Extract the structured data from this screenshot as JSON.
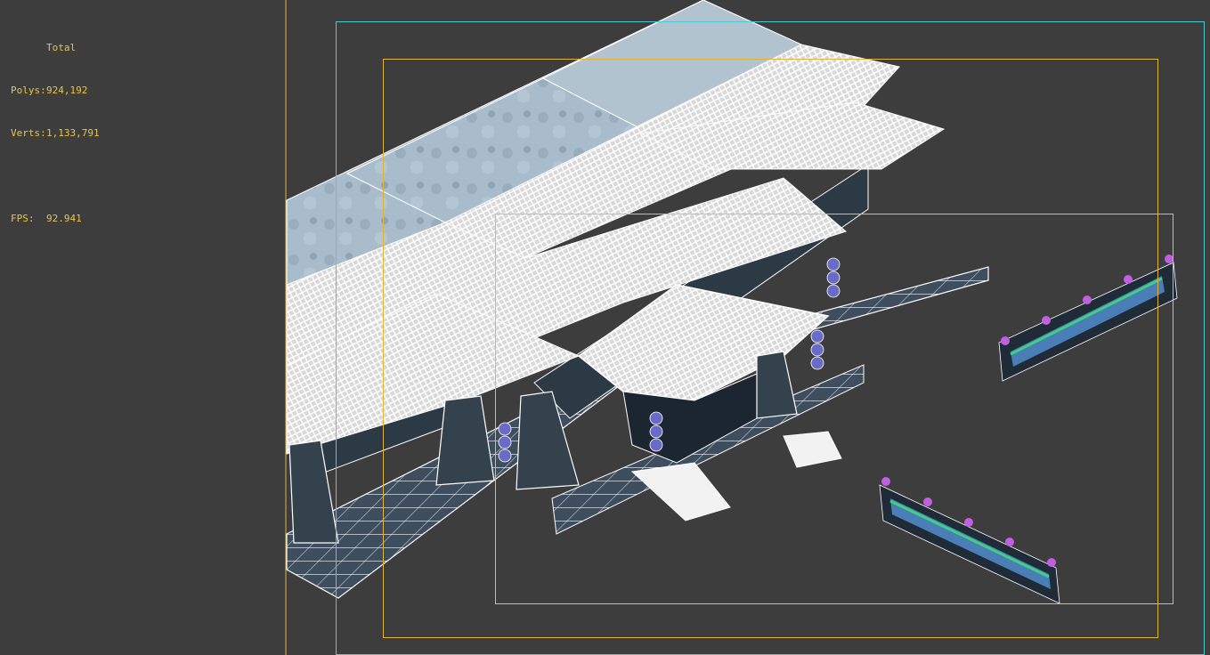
{
  "stats": {
    "header": "Total",
    "polys_label": "Polys:",
    "polys_value": "924,192",
    "verts_label": "Verts:",
    "verts_value": "1,133,791",
    "fps_label": "FPS:",
    "fps_value": "92.941"
  },
  "colors": {
    "background": "#3d3d3d",
    "stats_text": "#e8c64a",
    "safe_frame_outer": "#e0b43a",
    "safe_frame_cyan": "#4fc8d0",
    "safe_frame_inner": "#bcbcbc",
    "wireframe": "#ffffff",
    "roof_top": "#a9bccb",
    "tile_fill": "#3e4e5e",
    "railing_cap": "#c060e0",
    "railing_panel": "#5a9ae0",
    "railing_accent": "#40d080"
  },
  "icons": {
    "lantern": "lantern-icon",
    "railing_post": "railing-post-icon"
  }
}
